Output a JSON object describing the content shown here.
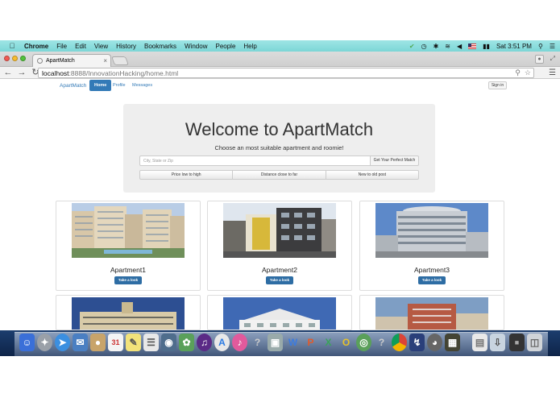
{
  "menubar": {
    "app": "Chrome",
    "items": [
      "File",
      "Edit",
      "View",
      "History",
      "Bookmarks",
      "Window",
      "People",
      "Help"
    ],
    "clock": "Sat 3:51 PM"
  },
  "browser": {
    "tab_title": "ApartMatch",
    "url_host": "localhost",
    "url_path": ":8888/InnovationHacking/home.html"
  },
  "nav": {
    "brand": "ApartMatch",
    "links": [
      "Home",
      "Profile",
      "Messages"
    ],
    "signin": "Sign in"
  },
  "hero": {
    "title": "Welcome to ApartMatch",
    "subtitle": "Choose an most suitable apartment and roomie!",
    "search_placeholder": "City, State or Zip",
    "search_button": "Get Your Perfect Match",
    "sort": [
      "Price low to high",
      "Distance close to far",
      "New to old post"
    ]
  },
  "listings": [
    {
      "name": "Apartment1",
      "button": "Take a look"
    },
    {
      "name": "Apartment2",
      "button": "Take a look"
    },
    {
      "name": "Apartment3",
      "button": "Take a look"
    }
  ],
  "colors": {
    "primary": "#337ab7",
    "menubar": "#8ddcdc",
    "jumbotron": "#eeeeee"
  }
}
